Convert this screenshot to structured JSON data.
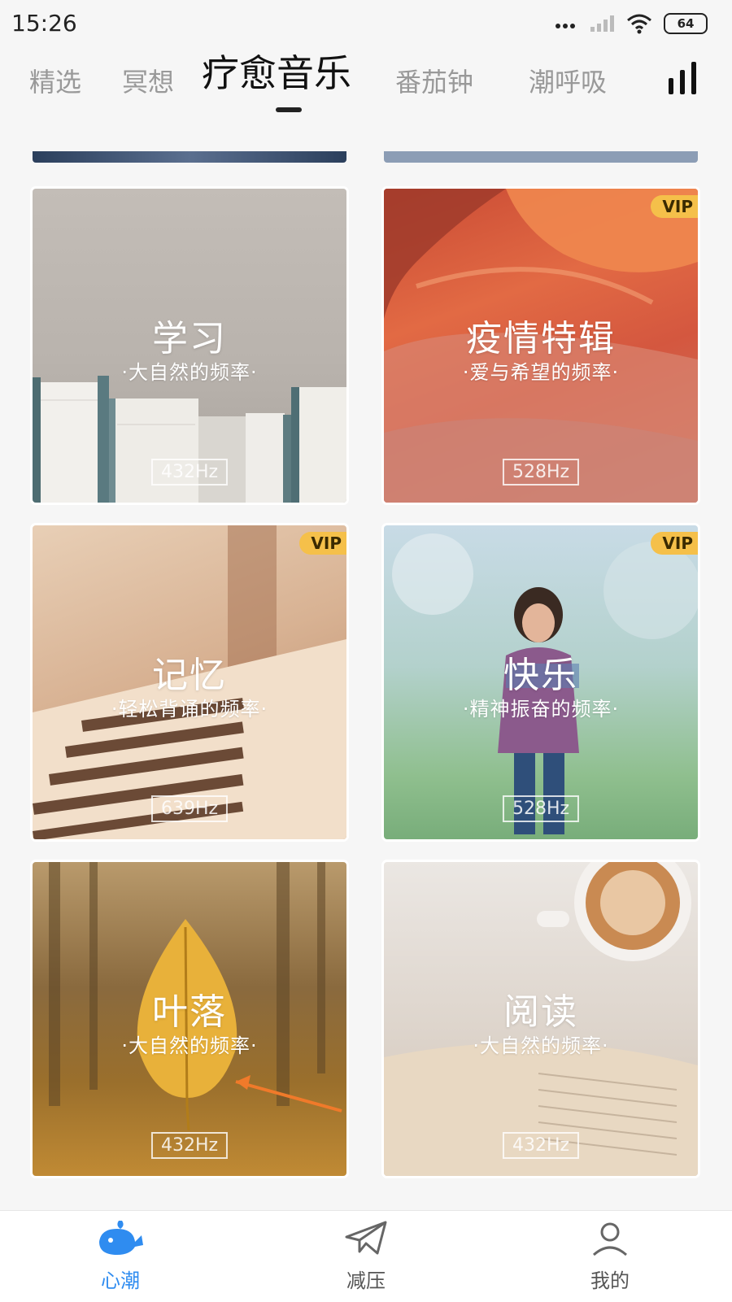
{
  "status": {
    "time": "15:26",
    "battery": "64"
  },
  "tabs": {
    "items": [
      {
        "label": "精选"
      },
      {
        "label": "冥想"
      },
      {
        "label": "疗愈音乐"
      },
      {
        "label": "番茄钟"
      },
      {
        "label": "潮呼吸"
      }
    ],
    "active": "疗愈音乐"
  },
  "cards": [
    {
      "title": "学习",
      "subtitle": "·大自然的频率·",
      "hz": "432Hz",
      "vip": ""
    },
    {
      "title": "疫情特辑",
      "subtitle": "·爱与希望的频率·",
      "hz": "528Hz",
      "vip": "VIP"
    },
    {
      "title": "记忆",
      "subtitle": "·轻松背诵的频率·",
      "hz": "639Hz",
      "vip": "VIP"
    },
    {
      "title": "快乐",
      "subtitle": "·精神振奋的频率·",
      "hz": "528Hz",
      "vip": "VIP"
    },
    {
      "title": "叶落",
      "subtitle": "·大自然的频率·",
      "hz": "432Hz",
      "vip": ""
    },
    {
      "title": "阅读",
      "subtitle": "·大自然的频率·",
      "hz": "432Hz",
      "vip": ""
    }
  ],
  "nav": {
    "items": [
      {
        "label": "心潮"
      },
      {
        "label": "减压"
      },
      {
        "label": "我的"
      }
    ],
    "active": "心潮"
  },
  "colors": {
    "accent": "#2f8cf0",
    "vip": "#f5c04a"
  }
}
